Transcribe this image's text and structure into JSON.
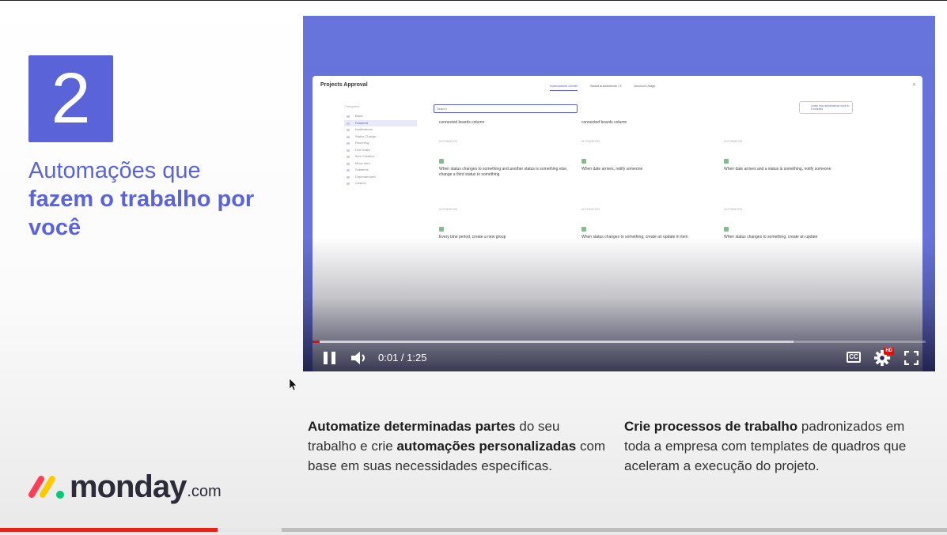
{
  "slide": {
    "step_number": "2",
    "headline_light": "Automações que",
    "headline_bold": "fazem o trabalho por você"
  },
  "logo": {
    "word": "monday",
    "suffix": ".com",
    "colors": [
      "#ff3d57",
      "#ffcb00",
      "#00ca72"
    ]
  },
  "embedded_video": {
    "app_title": "Projects Approval",
    "tabs": [
      "Automations Center",
      "Board automations / 5",
      "Account Usage"
    ],
    "sidebar_heading": "Categories",
    "sidebar_items": [
      "Basic",
      "Featured",
      "Notifications",
      "Status Change",
      "Recurring",
      "Due Dates",
      "Item Creation",
      "Move Item",
      "Subitems",
      "Dependencies",
      "Custom"
    ],
    "search_placeholder": "Search",
    "video_chip": "Learn how automations work in 5 minutes",
    "cards": [
      {
        "tag": "",
        "text": "connected boards column"
      },
      {
        "tag": "",
        "text": "connected boards column"
      },
      {
        "tag": "",
        "text": ""
      },
      {
        "tag": "AUTOMATION",
        "text": "When status changes to something and another status is something else, change a third status to something"
      },
      {
        "tag": "AUTOMATION",
        "text": "When date arrives, notify someone"
      },
      {
        "tag": "AUTOMATION",
        "text": "When date arrives and a status is something, notify someone"
      },
      {
        "tag": "AUTOMATION",
        "text": "Every time period, create a new group"
      },
      {
        "tag": "AUTOMATION",
        "text": "When status changes to something, create an update in item"
      },
      {
        "tag": "AUTOMATION",
        "text": "When status changes to something, create an update"
      }
    ],
    "player": {
      "time_current": "0:01",
      "time_separator": " / ",
      "time_total": "1:25",
      "played_fraction": 0.012,
      "buffered_fraction": 0.785,
      "cc_label": "CC",
      "hd_label": "HD"
    }
  },
  "description": {
    "col1": [
      {
        "text": "Automatize determinadas partes",
        "bold": true
      },
      {
        "text": " do seu trabalho e crie ",
        "bold": false
      },
      {
        "text": "automações personalizadas",
        "bold": true
      },
      {
        "text": " com base em suas necessidades específicas.",
        "bold": false
      }
    ],
    "col2": [
      {
        "text": "Crie processos de trabalho",
        "bold": true
      },
      {
        "text": " padronizados em toda a empresa com templates de quadros que aceleram a execução do projeto.",
        "bold": false
      }
    ]
  },
  "outer_player": {
    "played_fraction": 0.23,
    "buffered_fraction": 0.297
  },
  "colors": {
    "accent": "#5a64d8",
    "video_banner": "#6774dc",
    "progress_red": "#ff0000"
  }
}
